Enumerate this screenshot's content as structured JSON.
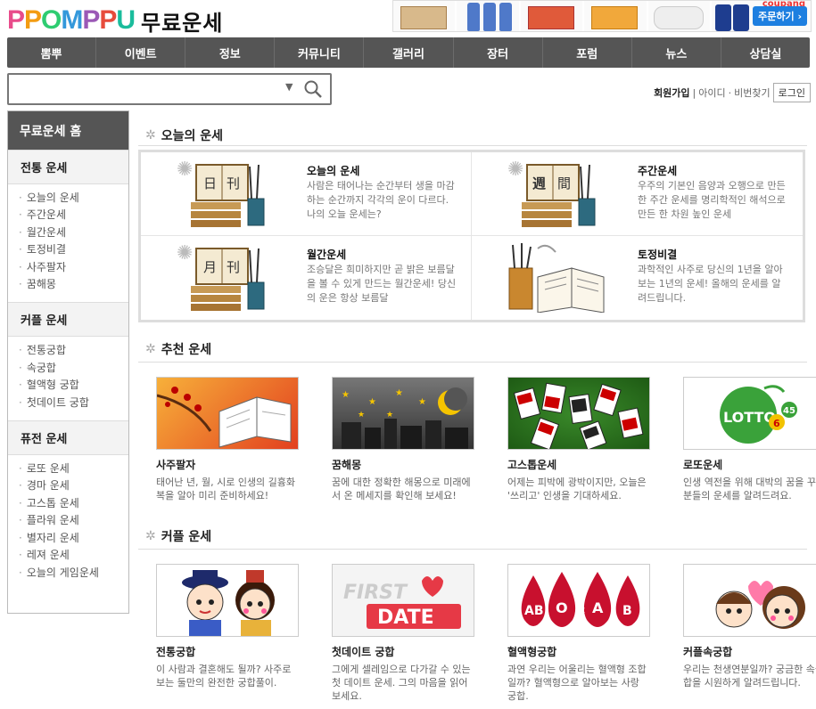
{
  "header": {
    "logo_text": "PPOMPPU",
    "title": "무료운세",
    "ad_button": "주문하기 ›",
    "ad_brand": "coupang"
  },
  "nav": [
    "뽐뿌",
    "이벤트",
    "정보",
    "커뮤니티",
    "갤러리",
    "장터",
    "포럼",
    "뉴스",
    "상담실"
  ],
  "search": {
    "placeholder": ""
  },
  "account": {
    "join": "회원가입",
    "id": "아이디",
    "pw": "비번찾기",
    "login": "로그인"
  },
  "sidebar": {
    "home": "무료운세 홈",
    "sections": [
      {
        "title": "전통 운세",
        "items": [
          "오늘의 운세",
          "주간운세",
          "월간운세",
          "토정비결",
          "사주팔자",
          "꿈해몽"
        ]
      },
      {
        "title": "커플 운세",
        "items": [
          "전통궁합",
          "속궁합",
          "혈액형 궁합",
          "첫데이트 궁합"
        ]
      },
      {
        "title": "퓨전 운세",
        "items": [
          "로또 운세",
          "경마 운세",
          "고스톱 운세",
          "플라워 운세",
          "별자리 운세",
          "레져 운세",
          "오늘의 게임운세"
        ]
      }
    ]
  },
  "today": {
    "title": "오늘의 운세",
    "items": [
      {
        "name": "오늘의 운세",
        "desc": "사람은 태어나는 순간부터 생을 마감하는 순간까지 각각의 운이 다르다. 나의 오늘 운세는?",
        "glyphs": [
          "日",
          "刊"
        ]
      },
      {
        "name": "주간운세",
        "desc": "우주의 기본인 음양과 오행으로 만든 한 주간 운세를 명리학적인 해석으로 만든 한 차원 높인 운세",
        "glyphs": [
          "週",
          "間"
        ]
      },
      {
        "name": "월간운세",
        "desc": "조승달은 희미하지만 곧 밝은 보름달을 볼 수 있게 만드는 월간운세! 당신의 운은 항상 보름달",
        "glyphs": [
          "月",
          "刊"
        ]
      },
      {
        "name": "토정비결",
        "desc": "과학적인 사주로 당신의 1년을 알아보는 1년의 운세! 올해의 운세를 알려드립니다.",
        "glyphs": [
          "",
          ""
        ]
      }
    ]
  },
  "recommend": {
    "title": "추천 운세",
    "items": [
      {
        "name": "사주팔자",
        "desc": "태어난 년, 월, 시로 인생의 길흉화복을 알아 미리 준비하세요!"
      },
      {
        "name": "꿈해몽",
        "desc": "꿈에 대한 정확한 해몽으로 미래에서 온 메세지를 확인해 보세요!"
      },
      {
        "name": "고스톱운세",
        "desc": "어제는 피박에 광박이지만, 오늘은 '쓰리고' 인생을 기대하세요."
      },
      {
        "name": "로또운세",
        "desc": "인생 역전을 위해 대박의 꿈을 꾸는 분들의 운세를 알려드려요."
      }
    ],
    "lotto": {
      "text": "LOTTO",
      "num1": "6",
      "num2": "45"
    }
  },
  "couple": {
    "title": "커플 운세",
    "items": [
      {
        "name": "전통궁합",
        "desc": "이 사람과 결혼해도 될까? 사주로 보는 둘만의 완전한 궁합풀이."
      },
      {
        "name": "첫데이트 궁합",
        "desc": "그에게 셀레임으로 다가갈 수 있는 첫 데이트 운세. 그의 마음을 읽어보세요."
      },
      {
        "name": "혈액형궁합",
        "desc": "과연 우리는 어울리는 혈액형 조합일까? 혈액형으로 알아보는 사랑 궁합."
      },
      {
        "name": "커플속궁합",
        "desc": "우리는 천생연분일까? 궁금한 속궁합을 시원하게 알려드립니다."
      }
    ],
    "firstdate": {
      "line1": "FIRST",
      "line2": "DATE"
    },
    "blood": [
      "AB",
      "O",
      "&",
      "A",
      "B"
    ]
  },
  "colors": {
    "nav": "#555555",
    "accent_blue": "#1d7fe0",
    "lotto_green": "#3aa23a",
    "blood_red": "#c8102e"
  }
}
